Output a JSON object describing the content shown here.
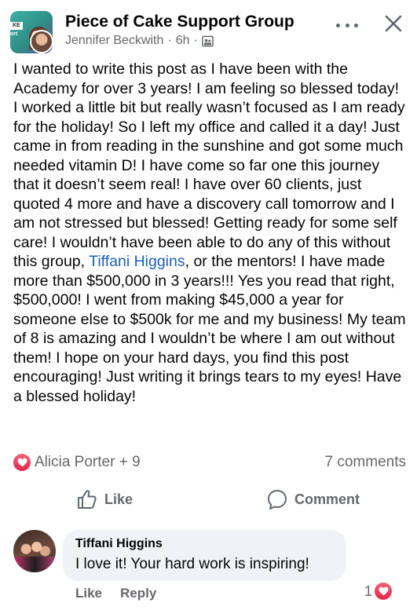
{
  "header": {
    "group_name": "Piece of Cake Support Group",
    "author": "Jennifer Beckwith",
    "separator": "·",
    "time": "6h",
    "privacy_separator": "·",
    "avatar_text_1": "KE",
    "avatar_text_2": "ort"
  },
  "post": {
    "text_before_mention": "I wanted to write this post as I have been with the Academy for over 3 years! I am feeling so blessed today! I worked a little bit but really wasn’t focused as I am ready for the holiday! So I left my office and called it a day! Just came in from reading in the sunshine and got some much needed vitamin D! I have come so far one this journey that it doesn’t seem real! I have over 60 clients, just quoted 4 more and have a discovery call tomorrow and I am not stressed but blessed! Getting ready for some self care!  I wouldn’t have been able to do any of this without this group, ",
    "mention": "Tiffani Higgins",
    "text_after_mention": ", or the mentors! I have made more than $500,000 in 3 years!!!  Yes you read that right, $500,000! I went from making $45,000 a year for someone else to $500k for me and my business! My team of 8 is amazing and I wouldn’t be where I am out without them! I hope on your hard days, you find this post encouraging! Just writing it brings tears to my eyes!  Have a blessed holiday!"
  },
  "reactions": {
    "reactors": "Alicia Porter + 9",
    "comment_count": "7 comments"
  },
  "actions": {
    "like_label": "Like",
    "comment_label": "Comment"
  },
  "comment": {
    "author": "Tiffani Higgins",
    "text": "I love it! Your hard work is inspiring!",
    "like_label": "Like",
    "reply_label": "Reply",
    "reaction_count": "1"
  },
  "colors": {
    "love": "#e3264a",
    "mention": "#1b5fb8",
    "secondary_text": "#65676b",
    "bubble": "#f0f2f5"
  },
  "icons": {
    "more": "more-horizontal-icon",
    "close": "close-icon",
    "privacy": "group-privacy-icon",
    "like": "thumbs-up-icon",
    "comment": "comment-bubble-icon",
    "love": "heart-icon"
  }
}
